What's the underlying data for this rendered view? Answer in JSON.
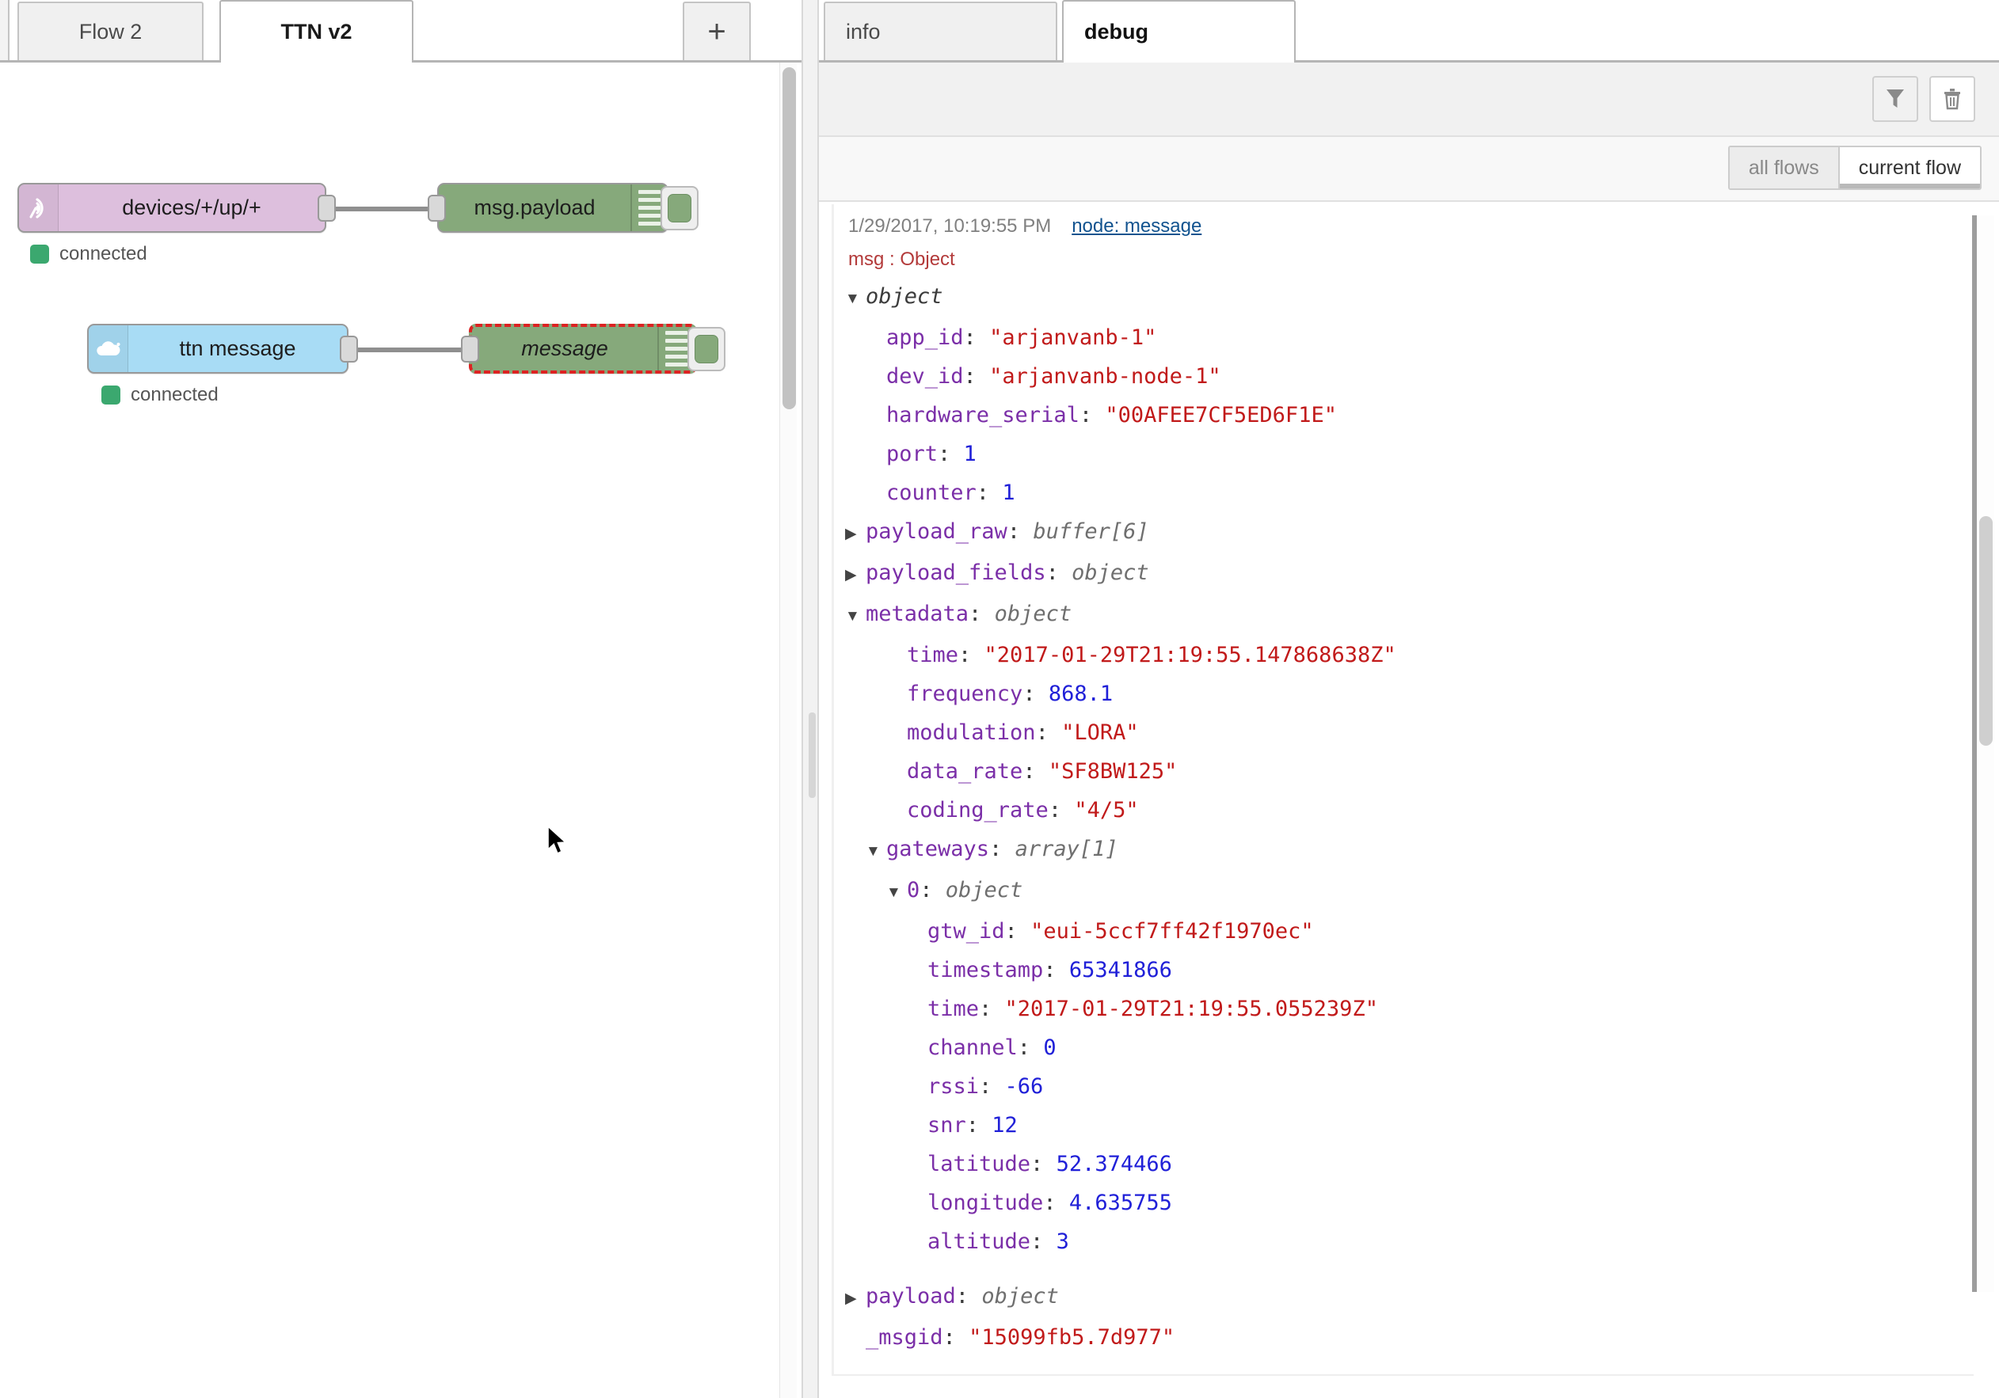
{
  "flow_editor": {
    "tabs": [
      {
        "id": "flow2",
        "label": "Flow 2",
        "active": false
      },
      {
        "id": "ttnv2",
        "label": "TTN v2",
        "active": true
      }
    ],
    "add_tab_label": "+",
    "nodes": [
      {
        "id": "mqtt-in",
        "label": "devices/+/up/+",
        "type": "mqtt-in",
        "icon": "broadcast-icon",
        "color": "#ddbfdd",
        "status": "connected",
        "status_color": "#3ba86f",
        "selected": false
      },
      {
        "id": "debug-payload",
        "label": "msg.payload",
        "type": "debug",
        "icon": "debug-lines-icon",
        "color": "#86a97b",
        "selected": false
      },
      {
        "id": "ttn-message",
        "label": "ttn message",
        "type": "ttn",
        "icon": "cloud-icon",
        "color": "#a8dcf5",
        "status": "connected",
        "status_color": "#3ba86f",
        "selected": false
      },
      {
        "id": "debug-message",
        "label": "message",
        "type": "debug",
        "icon": "debug-lines-icon",
        "color": "#86a97b",
        "selected": true
      }
    ]
  },
  "sidebar": {
    "tabs": [
      {
        "id": "info",
        "label": "info",
        "active": false
      },
      {
        "id": "debug",
        "label": "debug",
        "active": true
      }
    ],
    "toolbar": {
      "filter_label": "filter-icon",
      "clear_label": "trash-icon"
    },
    "flow_filter": {
      "options": [
        {
          "id": "all-flows",
          "label": "all flows",
          "active": false
        },
        {
          "id": "current-flow",
          "label": "current flow",
          "active": true
        }
      ]
    }
  },
  "debug_message": {
    "timestamp": "1/29/2017, 10:19:55 PM",
    "source": "node: message",
    "topic": "msg : Object",
    "root_label": "object",
    "rows": [
      {
        "indent": 0,
        "twisty": "down",
        "key": "object",
        "key_style": "plain",
        "value": "",
        "value_type": "none"
      },
      {
        "indent": 1,
        "twisty": "none",
        "key": "app_id",
        "key_style": "key",
        "value": "\"arjanvanb-1\"",
        "value_type": "string"
      },
      {
        "indent": 1,
        "twisty": "none",
        "key": "dev_id",
        "key_style": "key",
        "value": "\"arjanvanb-node-1\"",
        "value_type": "string"
      },
      {
        "indent": 1,
        "twisty": "none",
        "key": "hardware_serial",
        "key_style": "key",
        "value": "\"00AFEE7CF5ED6F1E\"",
        "value_type": "string"
      },
      {
        "indent": 1,
        "twisty": "none",
        "key": "port",
        "key_style": "key",
        "value": "1",
        "value_type": "number"
      },
      {
        "indent": 1,
        "twisty": "none",
        "key": "counter",
        "key_style": "key",
        "value": "1",
        "value_type": "number"
      },
      {
        "indent": 0,
        "twisty": "right",
        "key": "payload_raw",
        "key_style": "key",
        "value": "buffer[6]",
        "value_type": "type"
      },
      {
        "indent": 0,
        "twisty": "right",
        "key": "payload_fields",
        "key_style": "key",
        "value": "object",
        "value_type": "type"
      },
      {
        "indent": 0,
        "twisty": "down",
        "key": "metadata",
        "key_style": "key",
        "value": "object",
        "value_type": "type"
      },
      {
        "indent": 2,
        "twisty": "none",
        "key": "time",
        "key_style": "key",
        "value": "\"2017-01-29T21:19:55.147868638Z\"",
        "value_type": "string"
      },
      {
        "indent": 2,
        "twisty": "none",
        "key": "frequency",
        "key_style": "key",
        "value": "868.1",
        "value_type": "number"
      },
      {
        "indent": 2,
        "twisty": "none",
        "key": "modulation",
        "key_style": "key",
        "value": "\"LORA\"",
        "value_type": "string"
      },
      {
        "indent": 2,
        "twisty": "none",
        "key": "data_rate",
        "key_style": "key",
        "value": "\"SF8BW125\"",
        "value_type": "string"
      },
      {
        "indent": 2,
        "twisty": "none",
        "key": "coding_rate",
        "key_style": "key",
        "value": "\"4/5\"",
        "value_type": "string"
      },
      {
        "indent": 1,
        "twisty": "down",
        "key": "gateways",
        "key_style": "key",
        "value": "array[1]",
        "value_type": "type"
      },
      {
        "indent": 2,
        "twisty": "down",
        "key": "0",
        "key_style": "key",
        "value": "object",
        "value_type": "type"
      },
      {
        "indent": 3,
        "twisty": "none",
        "key": "gtw_id",
        "key_style": "key",
        "value": "\"eui-5ccf7ff42f1970ec\"",
        "value_type": "string"
      },
      {
        "indent": 3,
        "twisty": "none",
        "key": "timestamp",
        "key_style": "key",
        "value": "65341866",
        "value_type": "number"
      },
      {
        "indent": 3,
        "twisty": "none",
        "key": "time",
        "key_style": "key",
        "value": "\"2017-01-29T21:19:55.055239Z\"",
        "value_type": "string"
      },
      {
        "indent": 3,
        "twisty": "none",
        "key": "channel",
        "key_style": "key",
        "value": "0",
        "value_type": "number"
      },
      {
        "indent": 3,
        "twisty": "none",
        "key": "rssi",
        "key_style": "key",
        "value": "-66",
        "value_type": "number"
      },
      {
        "indent": 3,
        "twisty": "none",
        "key": "snr",
        "key_style": "key",
        "value": "12",
        "value_type": "number"
      },
      {
        "indent": 3,
        "twisty": "none",
        "key": "latitude",
        "key_style": "key",
        "value": "52.374466",
        "value_type": "number"
      },
      {
        "indent": 3,
        "twisty": "none",
        "key": "longitude",
        "key_style": "key",
        "value": "4.635755",
        "value_type": "number"
      },
      {
        "indent": 3,
        "twisty": "none",
        "key": "altitude",
        "key_style": "key",
        "value": "3",
        "value_type": "number"
      },
      {
        "indent": 0,
        "twisty": "right",
        "key": "payload",
        "key_style": "key",
        "value": "object",
        "value_type": "type"
      },
      {
        "indent": 0,
        "twisty": "none",
        "key": "_msgid",
        "key_style": "key",
        "value": "\"15099fb5.7d977\"",
        "value_type": "string"
      }
    ]
  },
  "colors": {
    "mqtt_node": "#ddbfdd",
    "ttn_node": "#a8dcf5",
    "debug_node": "#86a97b",
    "selection": "#dd2222",
    "status_connected": "#3ba86f",
    "json_key": "#7b2fa8",
    "json_string": "#c11a1a",
    "json_number": "#2020d8",
    "link": "#12538f",
    "topic": "#b33a3a"
  }
}
